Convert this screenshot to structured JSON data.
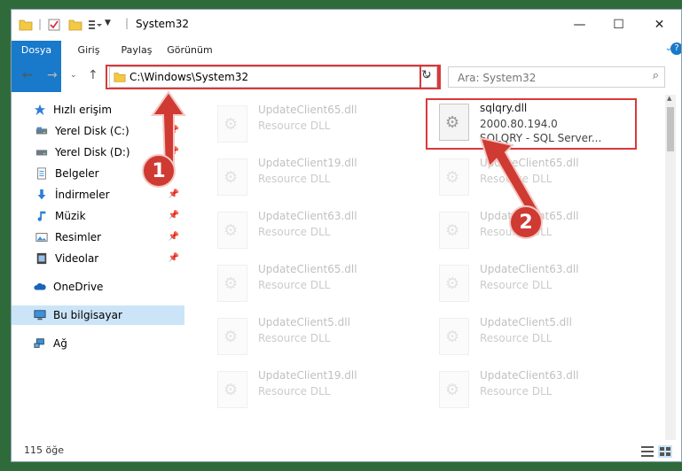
{
  "window": {
    "title": "System32"
  },
  "tabs": [
    {
      "label": "Dosya"
    },
    {
      "label": "Giriş"
    },
    {
      "label": "Paylaş"
    },
    {
      "label": "Görünüm"
    }
  ],
  "address": {
    "path": "C:\\Windows\\System32"
  },
  "search": {
    "placeholder": "Ara: System32"
  },
  "nav": [
    {
      "label": "Hızlı erişim",
      "icon": "star-icon"
    },
    {
      "label": "Yerel Disk (C:)",
      "icon": "drive-icon"
    },
    {
      "label": "Yerel Disk (D:)",
      "icon": "drive-icon"
    },
    {
      "label": "Belgeler",
      "icon": "documents-icon"
    },
    {
      "label": "İndirmeler",
      "icon": "download-icon"
    },
    {
      "label": "Müzik",
      "icon": "music-icon"
    },
    {
      "label": "Resimler",
      "icon": "pictures-icon"
    },
    {
      "label": "Videolar",
      "icon": "videos-icon"
    },
    {
      "label": "OneDrive",
      "icon": "cloud-icon"
    },
    {
      "label": "Bu bilgisayar",
      "icon": "computer-icon"
    },
    {
      "label": "Ağ",
      "icon": "network-icon"
    }
  ],
  "files": {
    "highlighted": {
      "name": "sqlqry.dll",
      "version": "2000.80.194.0",
      "description": "SQLQRY - SQL Server..."
    },
    "col1": [
      {
        "name": "UpdateClient65.dll",
        "type": "Resource DLL"
      },
      {
        "name": "UpdateClient19.dll",
        "type": "Resource DLL"
      },
      {
        "name": "UpdateClient63.dll",
        "type": "Resource DLL"
      },
      {
        "name": "UpdateClient65.dll",
        "type": "Resource DLL"
      },
      {
        "name": "UpdateClient5.dll",
        "type": "Resource DLL"
      },
      {
        "name": "UpdateClient19.dll",
        "type": "Resource DLL"
      }
    ],
    "col2": [
      {
        "name": "UpdateClient65.dll",
        "type": "Resource DLL"
      },
      {
        "name": "UpdateClient65.dll",
        "type": "Resource DLL"
      },
      {
        "name": "UpdateClient63.dll",
        "type": "Resource DLL"
      },
      {
        "name": "UpdateClient5.dll",
        "type": "Resource DLL"
      },
      {
        "name": "UpdateClient63.dll",
        "type": "Resource DLL"
      }
    ]
  },
  "status": {
    "count": "115 öğe"
  },
  "annotations": {
    "step1": "1",
    "step2": "2"
  },
  "colors": {
    "accent": "#1979ca",
    "highlight": "#d9393b",
    "badge": "#cf3a33"
  }
}
